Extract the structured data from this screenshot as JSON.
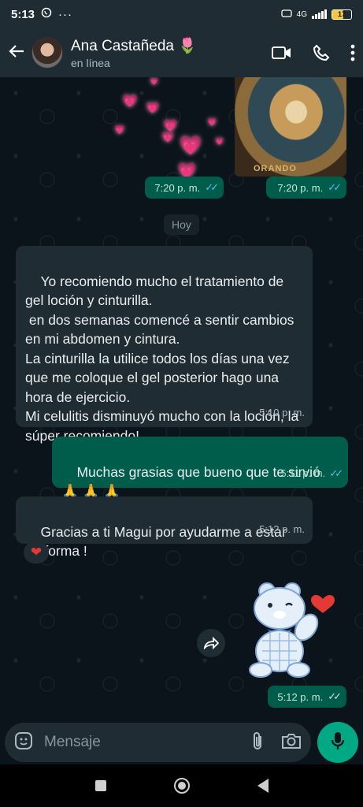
{
  "status_bar": {
    "time": "5:13",
    "network": "4G",
    "battery": "17"
  },
  "header": {
    "contact_name": "Ana Castañeda 🌷",
    "status": "en línea"
  },
  "chat": {
    "top_media": [
      {
        "time": "7:20 p. m."
      },
      {
        "time": "7:20 p. m.",
        "caption": "ORANDO"
      }
    ],
    "day_separator": "Hoy",
    "messages": [
      {
        "direction": "in",
        "text": "Yo recomiendo mucho el tratamiento de gel loción y cinturilla.\n en dos semanas comencé a sentir cambios en mi abdomen y cintura.\nLa cinturilla la utilice todos los días una vez que me coloque el gel posterior hago una hora de ejercicio.\nMi celulitis disminuyó mucho con la loción, la súper recomiendo!",
        "time": "5:10 p. m."
      },
      {
        "direction": "out",
        "text": "Muchas grasias que bueno que te sirvió\n🙏 🙏 🙏",
        "time": "5:11 p. m."
      },
      {
        "direction": "in",
        "text": "Gracias a ti Magui por ayudarme a estar en forma !",
        "time": "5:12 p. m.",
        "reaction": "❤"
      },
      {
        "direction": "out",
        "type": "sticker",
        "time": "5:12 p. m."
      }
    ]
  },
  "input": {
    "placeholder": "Mensaje"
  },
  "icons": [
    "back-arrow-icon",
    "video-call-icon",
    "phone-icon",
    "more-icon",
    "sticker-icon",
    "attach-icon",
    "camera-icon",
    "mic-icon",
    "forward-icon"
  ],
  "colors": {
    "header": "#1f2c34",
    "incoming": "#202c33",
    "outgoing": "#005c4b",
    "accent": "#00a884",
    "read_ticks": "#53bdeb"
  }
}
